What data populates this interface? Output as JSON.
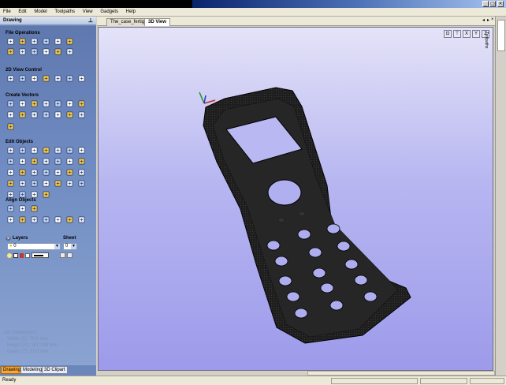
{
  "window": {
    "min_glyph": "_",
    "max_glyph": "□",
    "close_glyph": "×"
  },
  "menu": [
    "File",
    "Edit",
    "Model",
    "Toolpaths",
    "View",
    "Gadgets",
    "Help"
  ],
  "panel": {
    "title": "Drawing",
    "pin_glyph": "⊥",
    "sections": {
      "file_operations": "File Operations",
      "view_control": "2D View Control",
      "create_vectors": "Create Vectors",
      "edit_objects": "Edit Objects",
      "align_objects": "Align Objects"
    },
    "layers": {
      "label": "Layers",
      "sheet_label": "Sheet",
      "layer_value": "0",
      "sheet_value": "0"
    },
    "job_dimensions": {
      "title": "Job Dimensions",
      "width": "Width  (X): 70.0 mm",
      "height": "Height (Y): 167.249 mm",
      "depth": "Depth  (Z): 22.0 mm"
    },
    "bottom_tabs": [
      "Drawing",
      "Modeling",
      "3D Clipart"
    ]
  },
  "document": {
    "tabs": [
      "The_case_fertig",
      "3D View"
    ],
    "active_tab": "3D View",
    "controls": {
      "prev": "◂",
      "next": "▸",
      "close": "×"
    }
  },
  "viewport": {
    "background_top": "#e4e3f8",
    "background_bottom": "#9d9bea",
    "model_color": "#1a1a1a",
    "view_icons": [
      "iso-view-icon",
      "top-view-icon",
      "x-view-icon",
      "y-view-icon",
      "z-view-icon"
    ],
    "view_icon_labels": [
      "⊡",
      "⊤",
      "X",
      "Y",
      "Z"
    ]
  },
  "right_strip": {
    "tab_label": "Toolpaths"
  },
  "status": {
    "text": "Ready"
  },
  "colors": {
    "panel_blue": "#6a86bb",
    "active_tab_orange": "#f7a737"
  }
}
